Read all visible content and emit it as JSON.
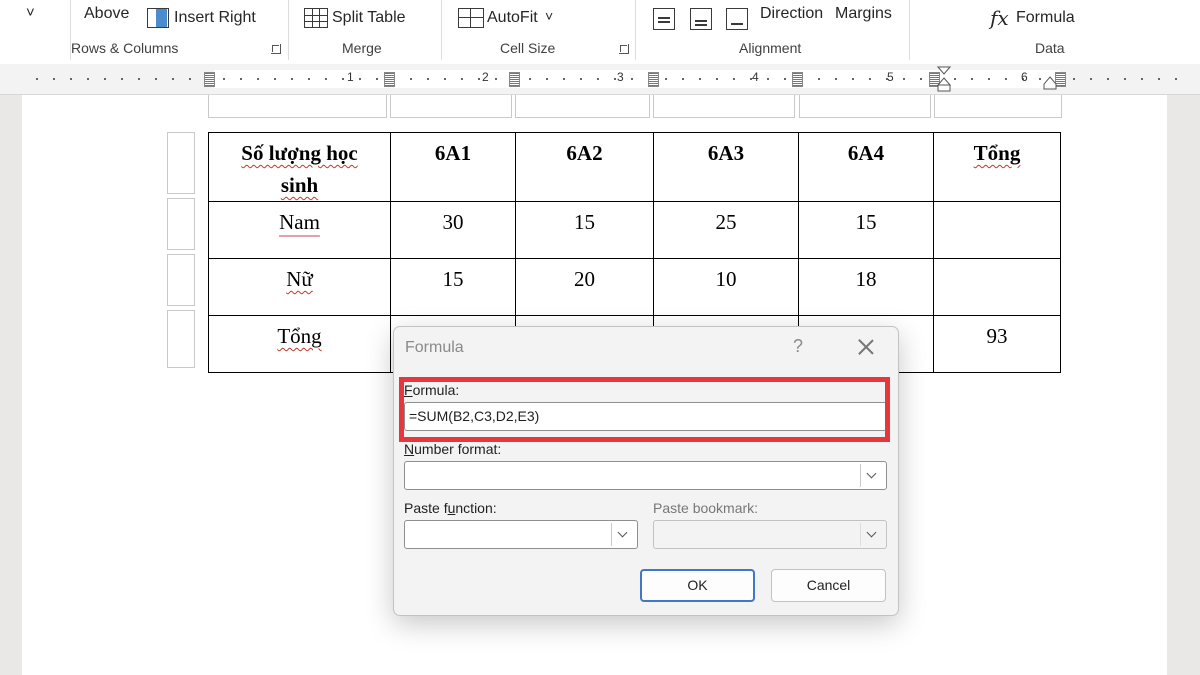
{
  "ribbon": {
    "dropdown_arrow": "˅",
    "insert_above_label": "Above",
    "insert_right_label": "Insert Right",
    "group_rows_columns": "Rows & Columns",
    "split_table_label": "Split Table",
    "group_merge": "Merge",
    "autofit_label": "AutoFit",
    "autofit_arrow": "˅",
    "group_cell_size": "Cell Size",
    "text_direction_label": "Direction",
    "cell_margins_label": "Margins",
    "group_alignment": "Alignment",
    "fx_symbol": "fx",
    "formula_label": "Formula",
    "group_data": "Data"
  },
  "ruler": {
    "numbers": [
      "1",
      "2",
      "3",
      "4",
      "5",
      "6"
    ]
  },
  "table": {
    "header": [
      "Số lượng học sinh",
      "6A1",
      "6A2",
      "6A3",
      "6A4",
      "Tổng"
    ],
    "header_first_line1": "Số lượng học",
    "header_first_line2": "sinh",
    "rows": [
      [
        "Nam",
        "30",
        "15",
        "25",
        "15",
        ""
      ],
      [
        "Nữ",
        "15",
        "20",
        "10",
        "18",
        ""
      ],
      [
        "Tổng",
        "",
        "",
        "",
        "",
        "93"
      ]
    ]
  },
  "dialog": {
    "title": "Formula",
    "help": "?",
    "formula_label_first": "F",
    "formula_label_rest": "ormula:",
    "formula_value": "=SUM(B2,C3,D2,E3)",
    "number_format_first": "N",
    "number_format_rest": "umber format:",
    "number_format_value": "",
    "paste_function_pre": "Paste f",
    "paste_function_ul": "u",
    "paste_function_post": "nction:",
    "paste_bookmark_label": "Paste bookmark:",
    "ok_label": "OK",
    "cancel_label": "Cancel"
  },
  "colors": {
    "highlight": "#e8363d",
    "accent": "#3f78c8"
  }
}
